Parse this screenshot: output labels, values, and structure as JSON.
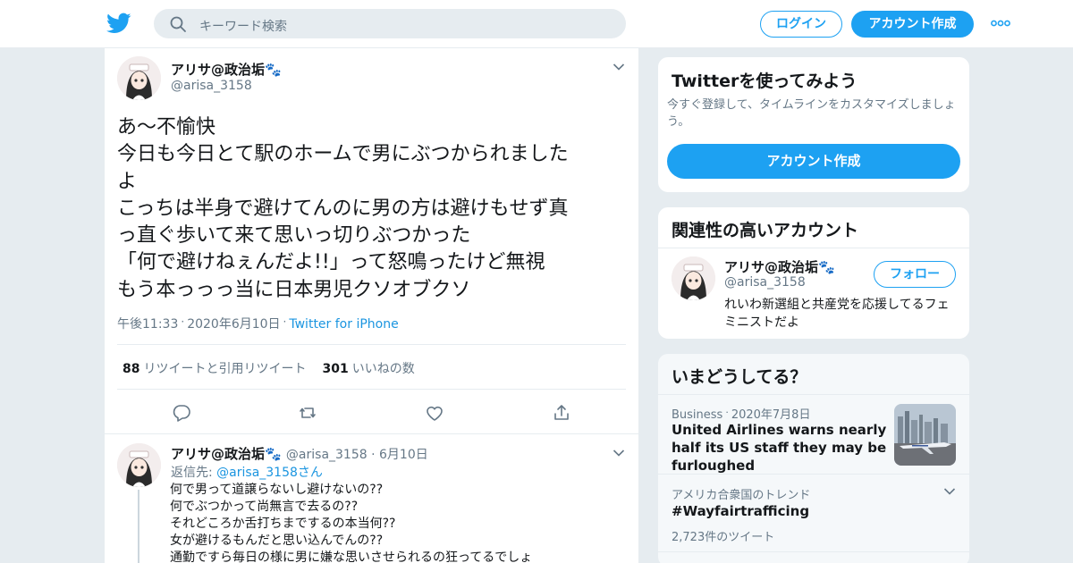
{
  "header": {
    "search_placeholder": "キーワード検索",
    "login_label": "ログイン",
    "signup_label": "アカウント作成",
    "brand_color": "#1da1f2"
  },
  "tweet": {
    "author_name": "アリサ@政治垢🐾",
    "author_handle": "@arisa_3158",
    "text": "あ〜不愉快\n今日も今日とて駅のホームで男にぶつかられました\nよ\nこっちは半身で避けてんのに男の方は避けもせず真\nっ直ぐ歩いて来て思いっ切りぶつかった\n「何で避けねぇんだよ!!」って怒鳴ったけど無視\nもう本っっっ当に日本男児クソオブクソ",
    "time": "午後11:33",
    "date": "2020年6月10日",
    "source": "Twitter for iPhone",
    "retweet_count": "88",
    "retweet_label": "リツイートと引用リツイート",
    "like_count": "301",
    "like_label": "いいねの数"
  },
  "reply": {
    "author_name": "アリサ@政治垢🐾",
    "author_handle": "@arisa_3158",
    "date": "6月10日",
    "reply_to_prefix": "返信先: ",
    "reply_to_handle": "@arisa_3158",
    "reply_to_suffix": "さん",
    "text": "何で男って道譲らないし避けないの??\n何でぶつかって尚無言で去るの??\nそれどころか舌打ちまでするの本当何??\n女が避けるもんだと思い込んでんの??\n通勤ですら毎日の様に男に嫌な思いさせられるの狂ってるでしょ"
  },
  "sidebar": {
    "signup_card": {
      "title": "Twitterを使ってみよう",
      "description": "今すぐ登録して、タイムラインをカスタマイズしましょう。",
      "button_label": "アカウント作成"
    },
    "related_card": {
      "title": "関連性の高いアカウント",
      "name": "アリサ@政治垢🐾",
      "handle": "@arisa_3158",
      "follow_label": "フォロー",
      "bio": "れいわ新選組と共産党を応援してるフェミニストだよ"
    },
    "trends_card": {
      "title": "いまどうしてる？",
      "items": [
        {
          "meta_category": "Business",
          "meta_date": "2020年7月8日",
          "title": "United Airlines warns nearly half its US staff they may be furloughed"
        },
        {
          "meta": "アメリカ合衆国のトレンド",
          "title": "#Wayfairtrafficing",
          "count": "2,723件のツイート"
        }
      ]
    }
  }
}
